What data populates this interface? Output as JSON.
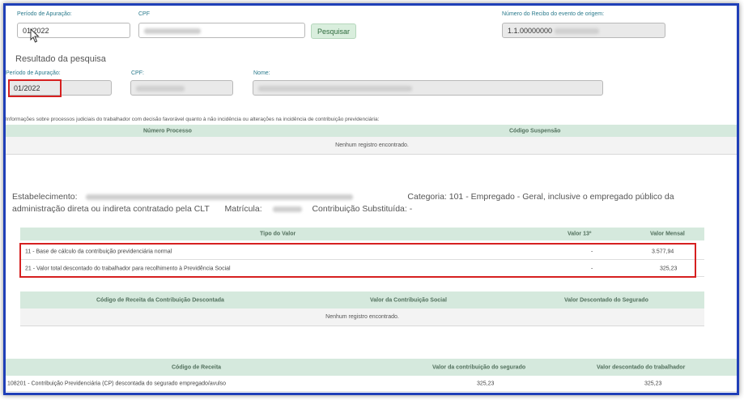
{
  "search": {
    "periodo_label": "Período de Apuração:",
    "periodo_value": "01/2022",
    "cpf_label": "CPF",
    "pesquisar_label": "Pesquisar",
    "recibo_label": "Número do Recibo do evento de origem:",
    "recibo_value": "1.1.00000000"
  },
  "result": {
    "title": "Resultado da pesquisa",
    "periodo_label": "Período de Apuração:",
    "periodo_value": "01/2022",
    "cpf_label": "CPF:",
    "nome_label": "Nome:"
  },
  "processos": {
    "info_text": "Informações sobre processos judiciais do trabalhador com decisão favorável quanto à não incidência ou alterações na incidência de contribuição previdenciária:",
    "col_numero": "Número Processo",
    "col_codigo": "Código Suspensão",
    "empty": "Nenhum registro encontrado."
  },
  "estabelecimento": {
    "label": "Estabelecimento:",
    "categoria": "Categoria: 101 - Empregado - Geral, inclusive o empregado público da",
    "line2": "administração direta ou indireta contratado pela CLT",
    "matricula_label": "Matrícula:",
    "contribuicao": "Contribuição Substituída: -"
  },
  "valores": {
    "col_tipo": "Tipo do Valor",
    "col_13": "Valor 13º",
    "col_mensal": "Valor Mensal",
    "rows": [
      {
        "tipo": "11 - Base de cálculo da contribuição previdenciária normal",
        "v13": "-",
        "mensal": "3.577,94"
      },
      {
        "tipo": "21 - Valor total descontado do trabalhador para recolhimento à Previdência Social",
        "v13": "-",
        "mensal": "325,23"
      }
    ]
  },
  "descontada": {
    "col_codigo": "Código de Receita da Contribuição Descontada",
    "col_valor": "Valor da Contribuição Social",
    "col_desc": "Valor Descontado do Segurado",
    "empty": "Nenhum registro encontrado."
  },
  "receita": {
    "col_codigo": "Código de Receita",
    "col_contrib": "Valor da contribuição do segurado",
    "col_desc": "Valor descontado do trabalhador",
    "row": {
      "codigo": "108201 - Contribuição Previdenciária (CP) descontada do segurado empregado/avulso",
      "contrib": "325,23",
      "desc": "325,23"
    }
  },
  "colors": {
    "frame": "#1f3fb8",
    "highlight": "#d62020",
    "table_header": "#d5e9dd",
    "label": "#2a7a8c"
  }
}
